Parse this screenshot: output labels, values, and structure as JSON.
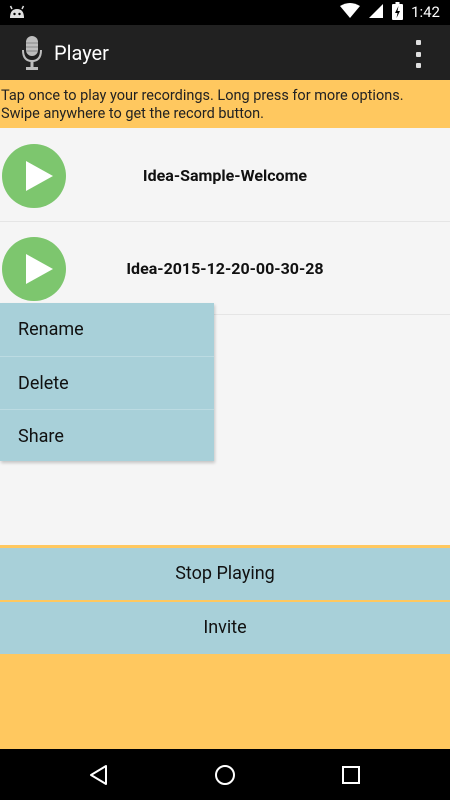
{
  "status_bar": {
    "time": "1:42"
  },
  "action_bar": {
    "title": "Player"
  },
  "instructions": {
    "line1": "Tap once to play your recordings. Long press for more options.",
    "line2": "Swipe anywhere to get the record button."
  },
  "recordings": [
    {
      "title": "Idea-Sample-Welcome"
    },
    {
      "title": "Idea-2015-12-20-00-30-28"
    }
  ],
  "context_menu": {
    "items": [
      "Rename",
      "Delete",
      "Share"
    ]
  },
  "buttons": {
    "stop": "Stop Playing",
    "invite": "Invite"
  },
  "colors": {
    "accent": "#ffc85f",
    "button_bg": "#a8d0d9",
    "play_green": "#7dc66e",
    "action_bar": "#212121"
  },
  "icons": [
    "android-icon",
    "wifi-icon",
    "signal-icon",
    "battery-charging-icon",
    "microphone-icon",
    "overflow-menu-icon",
    "play-icon",
    "back-icon",
    "home-icon",
    "recents-icon"
  ]
}
